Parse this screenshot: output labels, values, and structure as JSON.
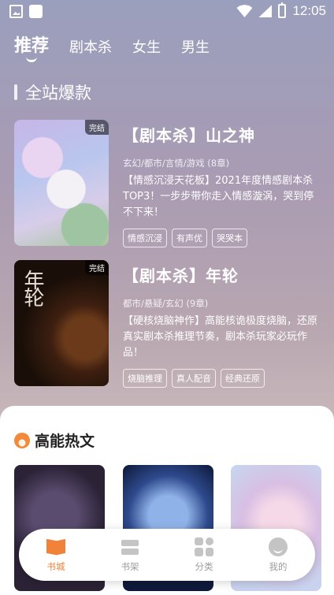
{
  "status_bar": {
    "time": "12:05"
  },
  "top_tabs": [
    "推荐",
    "剧本杀",
    "女生",
    "男生"
  ],
  "section_title": "全站爆款",
  "books": [
    {
      "badge": "完结",
      "title": "【剧本杀】山之神",
      "meta": "玄幻/都市/言情/游戏 (8章)",
      "desc": "【情感沉浸天花板】2021年度情感剧本杀TOP3！一步步带你走入情感漩涡，哭到停不下来！",
      "tags": [
        "情感沉浸",
        "有声优",
        "哭哭本"
      ]
    },
    {
      "badge": "完结",
      "cover_text": "年轮",
      "title": "【剧本杀】年轮",
      "meta": "都市/悬疑/玄幻 (9章)",
      "desc": "【硬核烧脑神作】高能核诡极度烧脑，还原真实剧本杀推理节奏，剧本杀玩家必玩作品！",
      "tags": [
        "烧脑推理",
        "真人配音",
        "经典还原"
      ]
    }
  ],
  "hot_section": {
    "title": "高能热文"
  },
  "tabbar": {
    "items": [
      {
        "label": "书城",
        "icon": "book-icon",
        "active": true
      },
      {
        "label": "书架",
        "icon": "shelf-icon",
        "active": false
      },
      {
        "label": "分类",
        "icon": "category-icon",
        "active": false
      },
      {
        "label": "我的",
        "icon": "profile-icon",
        "active": false
      }
    ]
  },
  "colors": {
    "accent": "#f0823a",
    "inactive": "#9a9a9a"
  }
}
